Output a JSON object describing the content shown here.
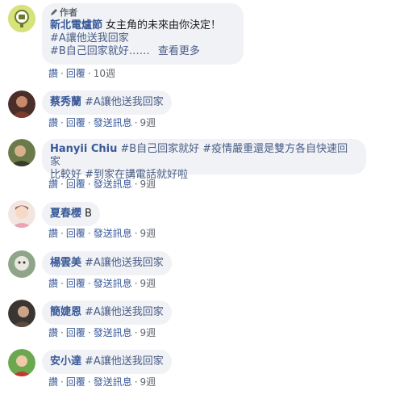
{
  "comments": [
    {
      "author_badge": "作者",
      "name": "新北電爐節",
      "text_lines": [
        {
          "parts": [
            {
              "t": "女主角的未來由你決定！",
              "tag": false
            }
          ]
        },
        {
          "parts": [
            {
              "t": "#A讓他送我回家",
              "tag": true
            }
          ]
        },
        {
          "parts": [
            {
              "t": "#B自己回家就好……",
              "tag": true
            }
          ],
          "more": "查看更多"
        }
      ],
      "actions": {
        "like": "讚",
        "reply": "回覆",
        "time": "10週"
      }
    },
    {
      "name": "蔡秀蘭",
      "text_lines": [
        {
          "parts": [
            {
              "t": "#A讓他送我回家",
              "tag": true
            }
          ]
        }
      ],
      "actions": {
        "like": "讚",
        "reply": "回覆",
        "send": "發送訊息",
        "time": "9週"
      }
    },
    {
      "name": "Hanyii Chiu",
      "text_lines": [
        {
          "parts": [
            {
              "t": "#B自己回家就好 #疫情嚴重還是雙方各自快速回家",
              "tag": true
            }
          ]
        },
        {
          "parts": [
            {
              "t": "比較好 #到家在講電話就好啦",
              "tag": true
            }
          ]
        }
      ],
      "actions": {
        "like": "讚",
        "reply": "回覆",
        "send": "發送訊息",
        "time": "9週"
      }
    },
    {
      "name": "夏春櫻",
      "text_lines": [
        {
          "parts": [
            {
              "t": "B",
              "tag": false
            }
          ]
        }
      ],
      "actions": {
        "like": "讚",
        "reply": "回覆",
        "send": "發送訊息",
        "time": "9週"
      }
    },
    {
      "name": "楊雲美",
      "text_lines": [
        {
          "parts": [
            {
              "t": "#A讓他送我回家",
              "tag": true
            }
          ]
        }
      ],
      "actions": {
        "like": "讚",
        "reply": "回覆",
        "send": "發送訊息",
        "time": "9週"
      }
    },
    {
      "name": "簡婕恩",
      "text_lines": [
        {
          "parts": [
            {
              "t": "#A讓他送我回家",
              "tag": true
            }
          ]
        }
      ],
      "actions": {
        "like": "讚",
        "reply": "回覆",
        "send": "發送訊息",
        "time": "9週"
      }
    },
    {
      "name": "安小達",
      "text_lines": [
        {
          "parts": [
            {
              "t": "#A讓他送我回家",
              "tag": true
            }
          ]
        }
      ],
      "actions": {
        "like": "讚",
        "reply": "回覆",
        "send": "發送訊息",
        "time": "9週"
      }
    }
  ],
  "colors": {
    "bubble": "#f0f2f5",
    "name": "#385898",
    "hashtag": "#4a5d87",
    "meta": "#606770"
  },
  "icons": [
    "pencil-icon"
  ]
}
